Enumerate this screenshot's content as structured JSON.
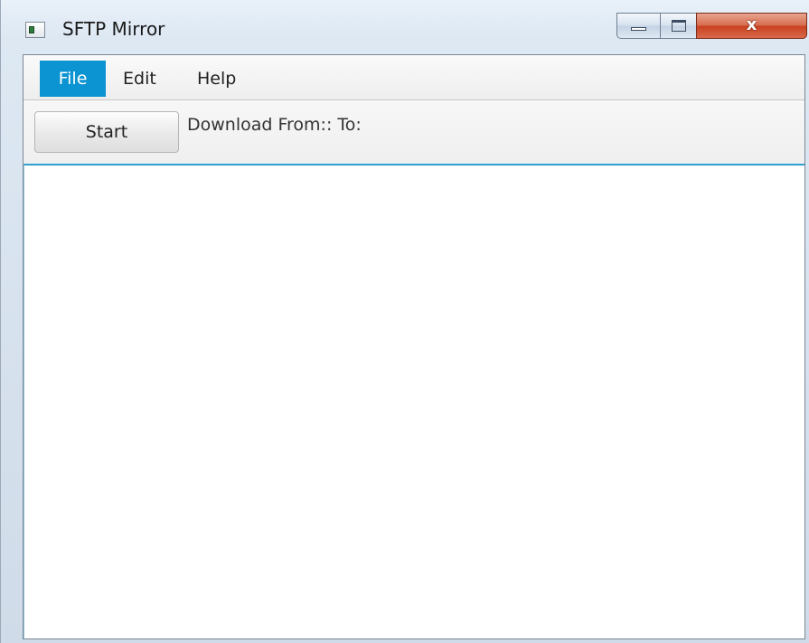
{
  "window": {
    "title": "SFTP Mirror",
    "app_icon": "window-app-icon",
    "caption_buttons": {
      "minimize_icon": "minimize-icon",
      "maximize_icon": "maximize-icon",
      "close_icon": "close-icon",
      "close_glyph": "x"
    }
  },
  "menubar": {
    "items": [
      {
        "label": "File",
        "active": true
      },
      {
        "label": "Edit",
        "active": false
      },
      {
        "label": "Help",
        "active": false
      }
    ]
  },
  "toolbar": {
    "start_label": "Start",
    "status_text": "Download From:: To:"
  },
  "colors": {
    "menu_active_bg": "#0c93d2",
    "content_focus_border": "#2f9fcf",
    "close_button": "#c8401f"
  }
}
